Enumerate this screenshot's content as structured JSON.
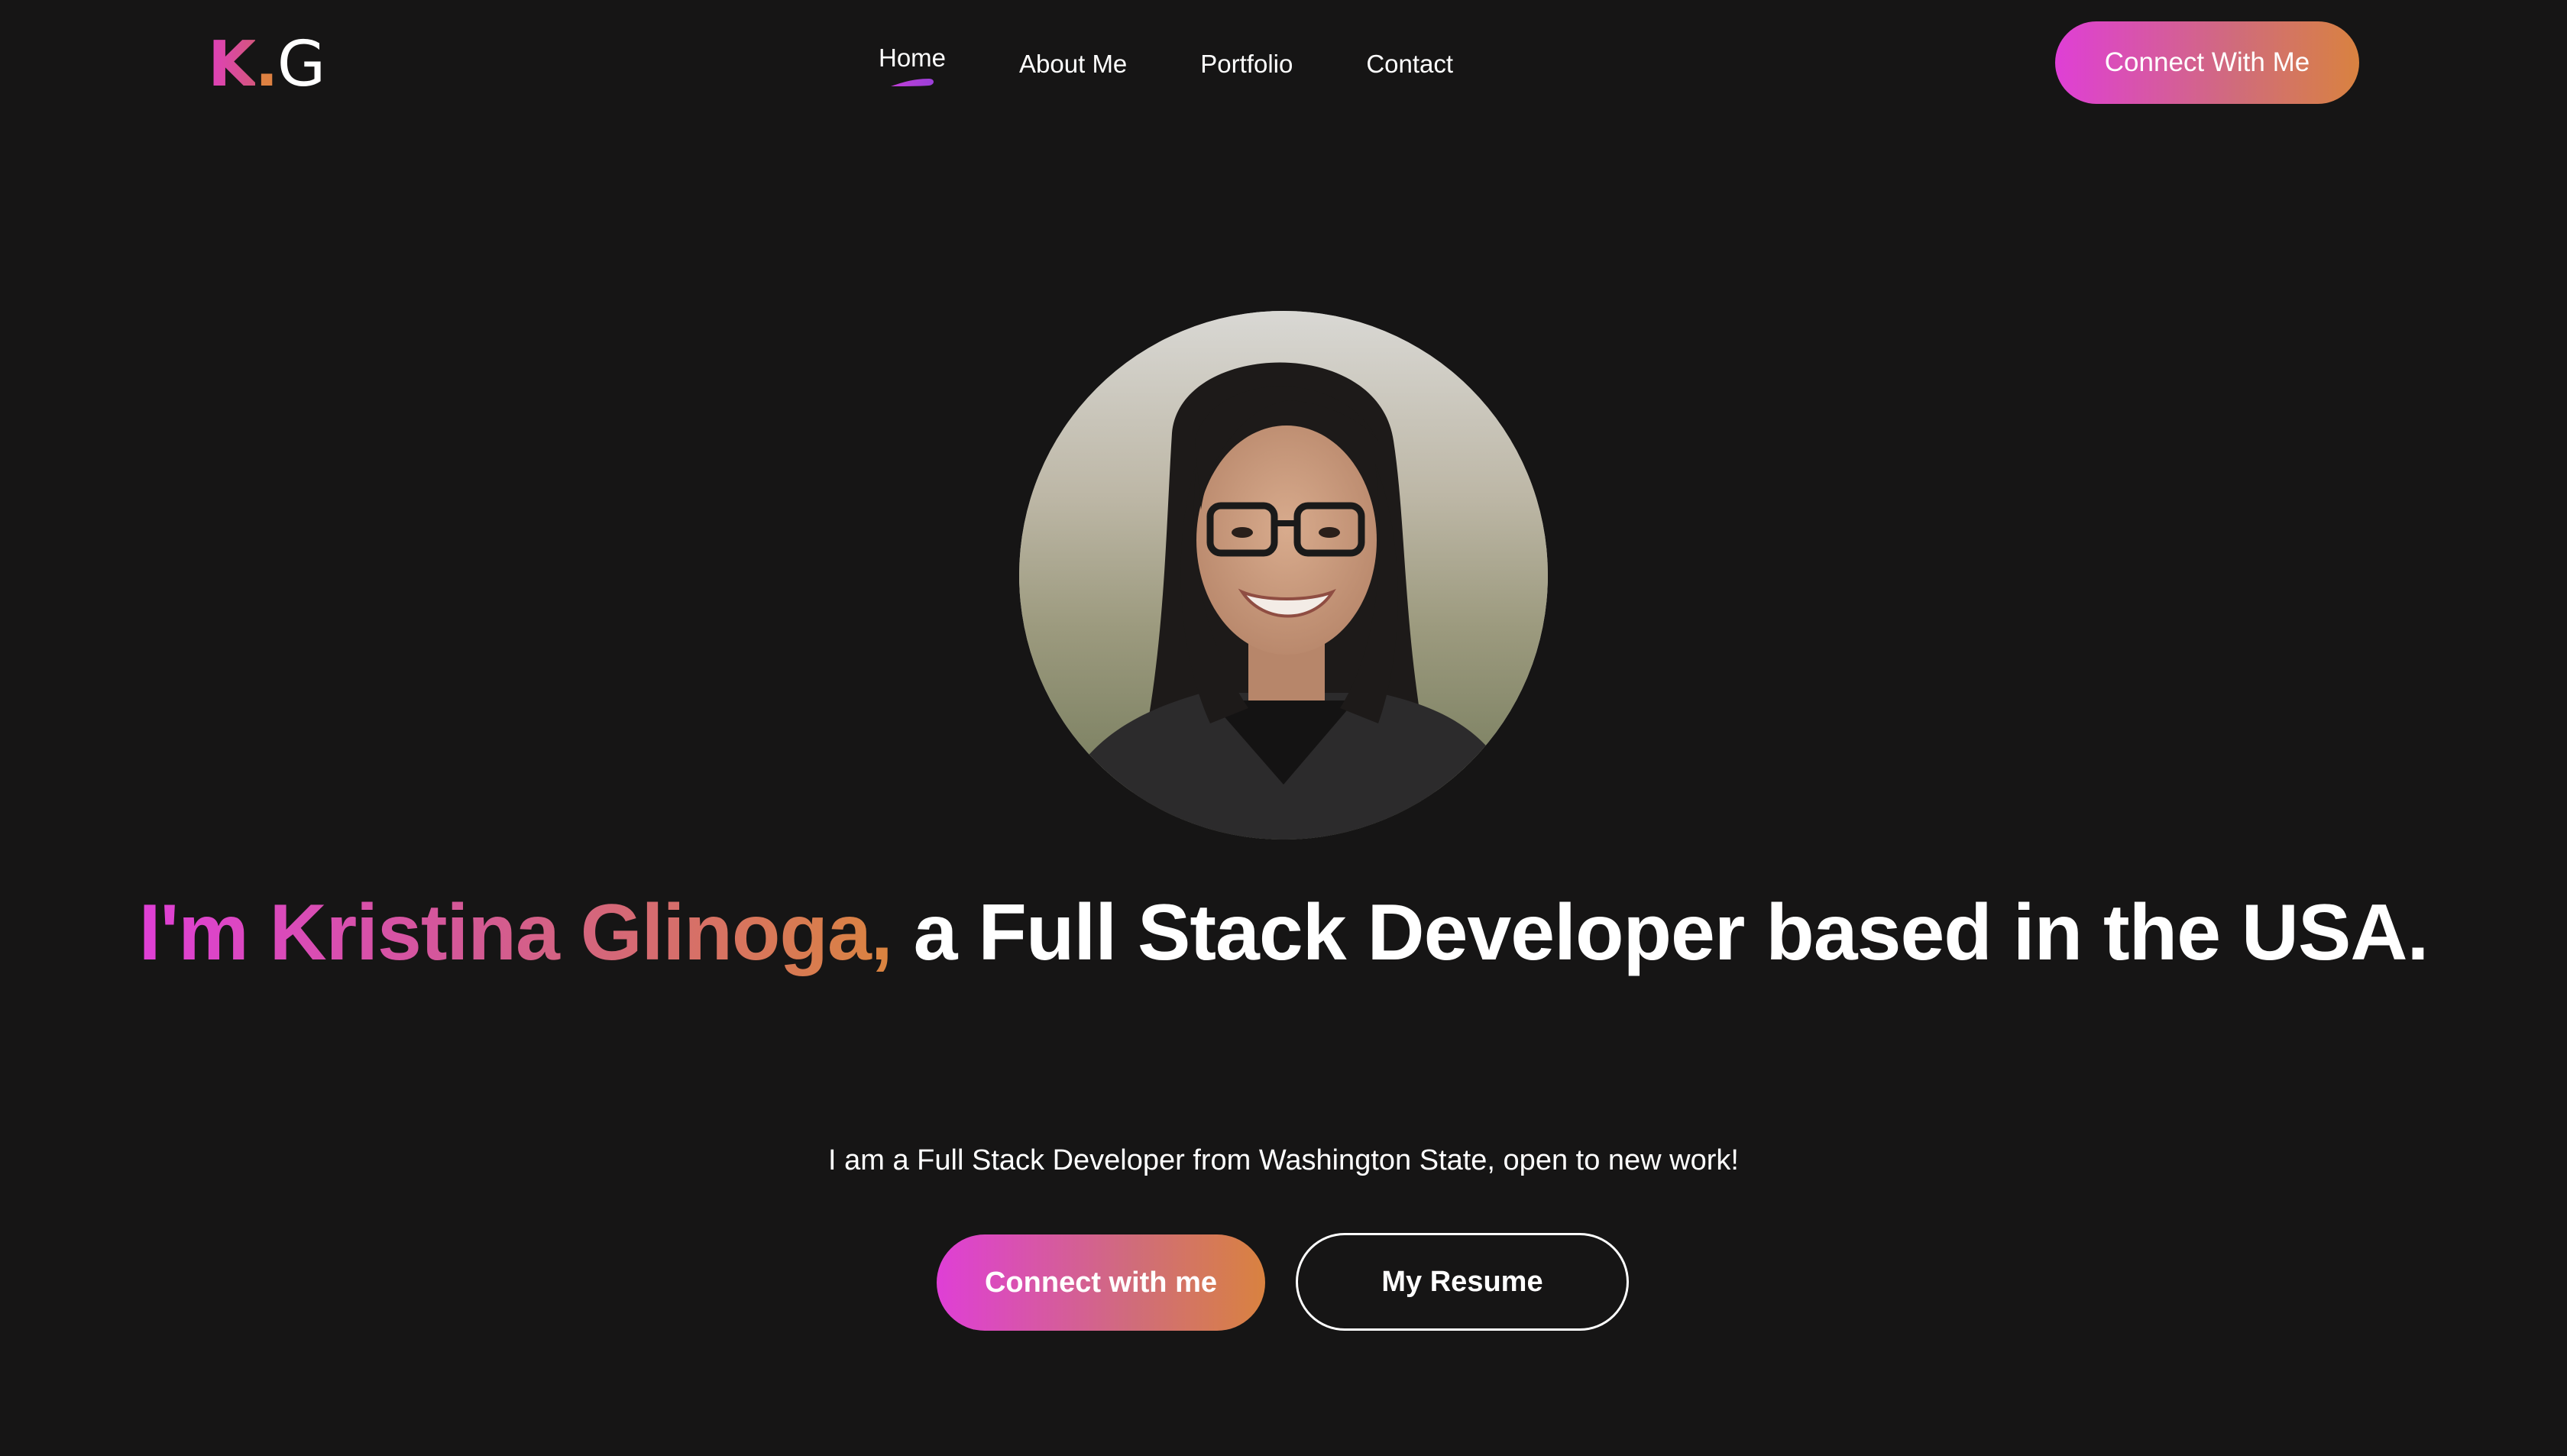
{
  "brand": {
    "logo_initial_1": "K",
    "logo_dot": ".",
    "logo_initial_2": "G"
  },
  "nav": {
    "items": [
      {
        "label": "Home",
        "active": true
      },
      {
        "label": "About Me",
        "active": false
      },
      {
        "label": "Portfolio",
        "active": false
      },
      {
        "label": "Contact",
        "active": false
      }
    ]
  },
  "header": {
    "cta_label": "Connect With Me"
  },
  "hero": {
    "avatar_alt": "Portrait of Kristina Glinoga",
    "headline_highlight": "I'm Kristina Glinoga,",
    "headline_rest": " a Full Stack Developer based in the USA.",
    "subtext": "I am a Full Stack Developer from Washington State, open to new work!",
    "primary_cta": "Connect with me",
    "secondary_cta": "My Resume"
  },
  "colors": {
    "background": "#161515",
    "gradient_start": "#df3fd6",
    "gradient_end": "#d98240",
    "text": "#ffffff"
  }
}
